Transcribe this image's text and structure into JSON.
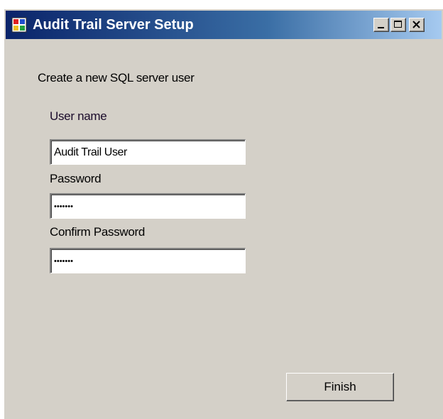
{
  "window": {
    "title": "Audit Trail Server Setup"
  },
  "caption_buttons": {
    "minimize_icon": "minimize-icon",
    "maximize_icon": "maximize-icon",
    "close_icon": "close-icon"
  },
  "form": {
    "heading": "Create a new SQL server user",
    "username_label": "User name",
    "username_value": "Audit Trail User",
    "password_label": "Password",
    "password_value": "•••••••",
    "confirm_label": "Confirm  Password",
    "confirm_value": "•••••••"
  },
  "actions": {
    "finish_label": "Finish"
  },
  "colors": {
    "dialog_background": "#d4d0c8",
    "titlebar_start": "#0a246a",
    "titlebar_end": "#a6caf0",
    "title_text": "#ffffff"
  }
}
